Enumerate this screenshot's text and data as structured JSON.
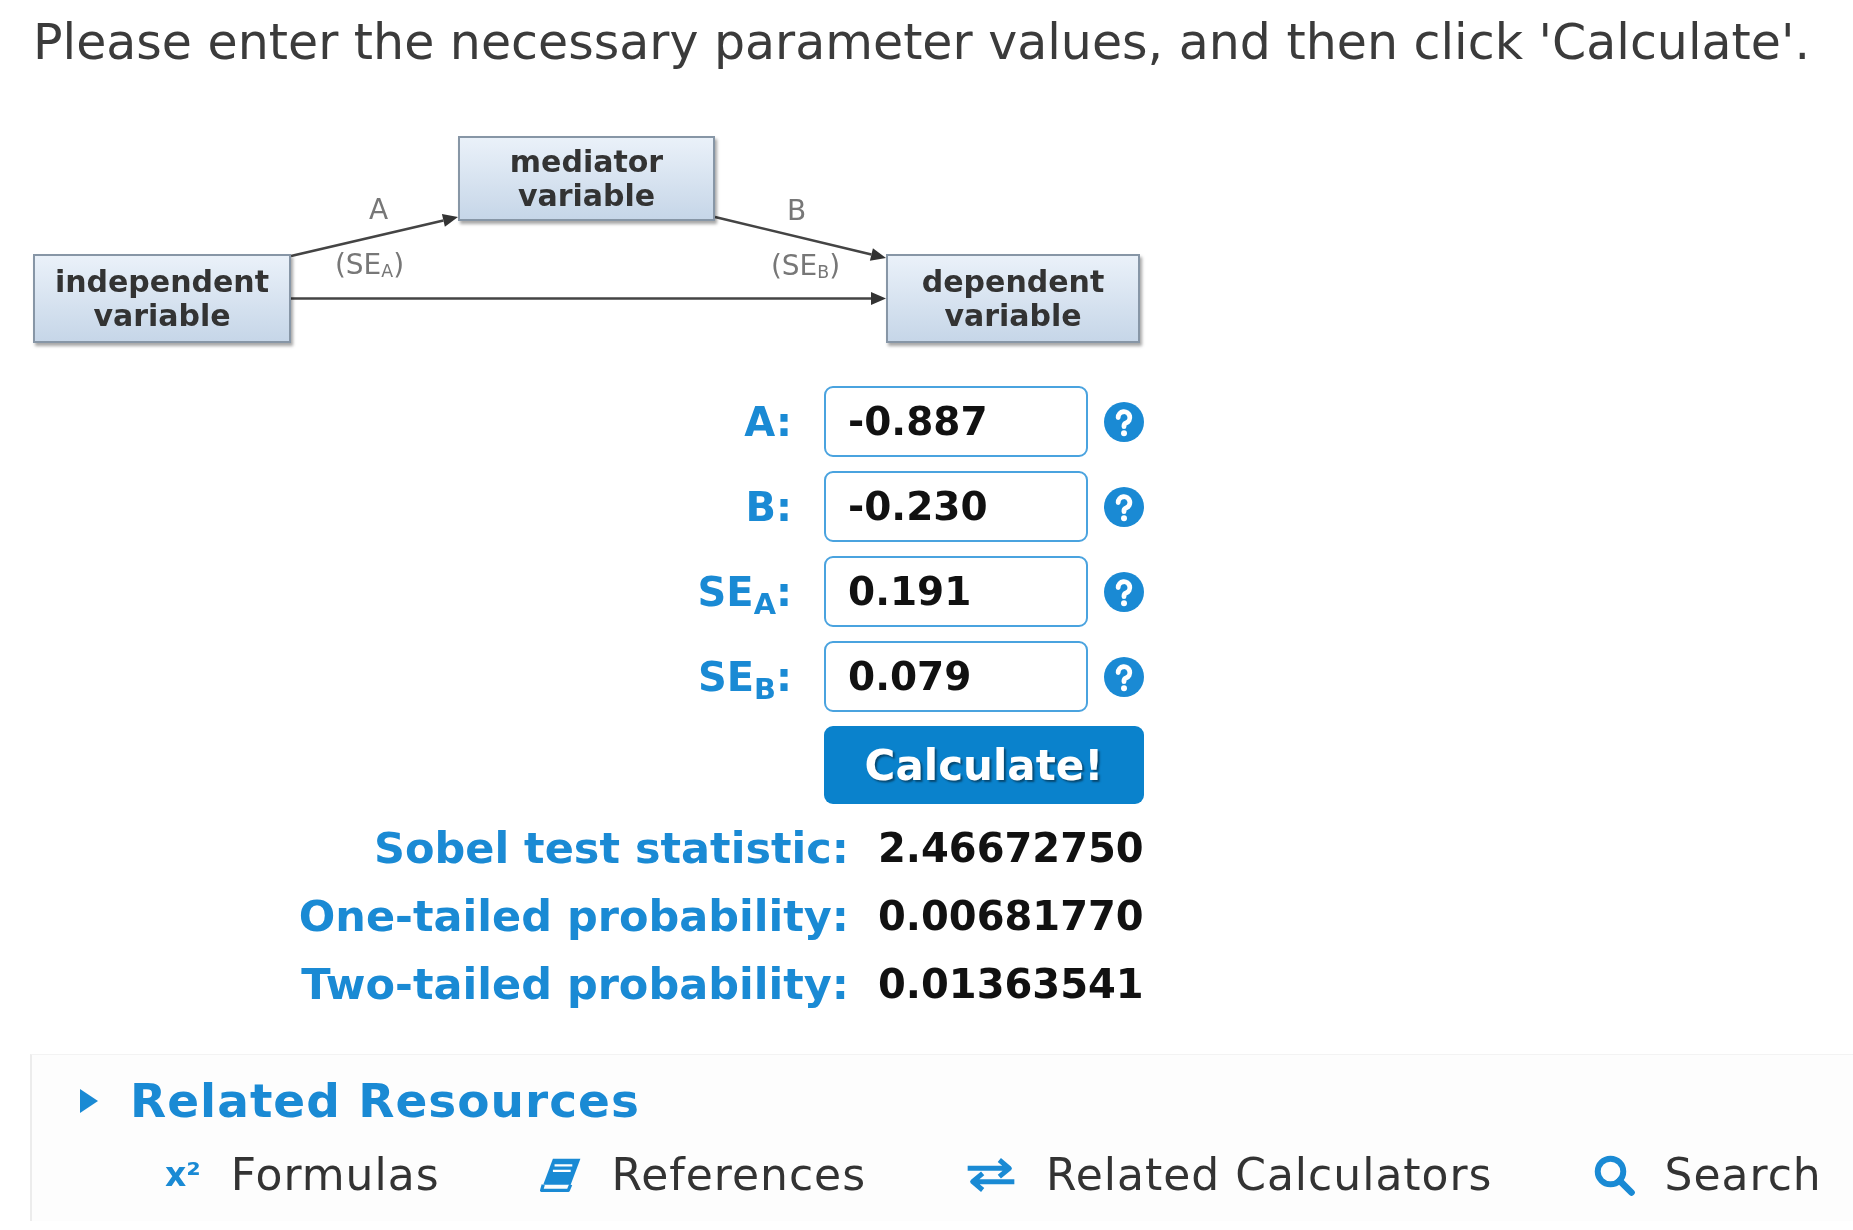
{
  "instruction": "Please enter the necessary parameter values, and then click 'Calculate'.",
  "diagram": {
    "nodes": [
      {
        "label": "independent variable"
      },
      {
        "label": "mediator variable"
      },
      {
        "label": "dependent variable"
      }
    ],
    "edges": [
      {
        "kind": "path",
        "label": "A",
        "se_label": "(SE$_{A}$)"
      },
      {
        "kind": "path",
        "label": "B",
        "se_label": "(SE$_{B}$)"
      },
      {
        "kind": "direct"
      }
    ]
  },
  "form": {
    "fields": [
      {
        "label": "A:",
        "value": "-0.887"
      },
      {
        "label": "B:",
        "value": "-0.230"
      },
      {
        "label": "SE$_{A}$:",
        "value": "0.191"
      },
      {
        "label": "SE$_{B}$:",
        "value": "0.079"
      }
    ],
    "submit_button": "Calculate!"
  },
  "results": [
    {
      "label": "Sobel test statistic:",
      "value": "2.46672750"
    },
    {
      "label": "One-tailed probability:",
      "value": "0.00681770"
    },
    {
      "label": "Two-tailed probability:",
      "value": "0.01363541"
    }
  ],
  "related_resources": {
    "title": "Related Resources",
    "links": [
      {
        "kind": "formulas",
        "symbol": "x²",
        "label": "Formulas"
      },
      {
        "kind": "references",
        "label": "References"
      },
      {
        "kind": "related",
        "label": "Related Calculators"
      },
      {
        "kind": "search",
        "label": "Search"
      }
    ]
  }
}
